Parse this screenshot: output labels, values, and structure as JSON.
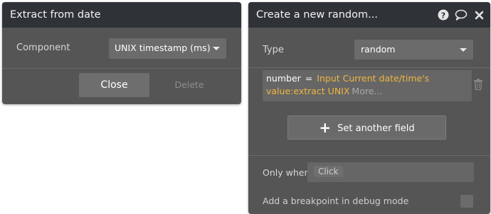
{
  "left_panel": {
    "title": "Extract from date",
    "component_label": "Component",
    "component_value": "UNIX timestamp (ms)",
    "close_label": "Close",
    "delete_label": "Delete"
  },
  "right_panel": {
    "title": "Create a new random...",
    "type_label": "Type",
    "type_value": "random",
    "field": {
      "key": "number",
      "operator": "=",
      "expression": "Input Current date/time's value:extract UNIX",
      "more_label": "More..."
    },
    "set_another_label": "Set another field",
    "only_when_label": "Only when",
    "only_when_placeholder": "Click",
    "breakpoint_label": "Add a breakpoint in debug mode"
  },
  "icons": {
    "help": "help-circle-icon",
    "comment": "comment-bubble-icon",
    "close": "close-x-icon",
    "trash": "trash-icon",
    "plus": "plus-icon",
    "caret": "chevron-down-icon"
  },
  "colors": {
    "header_bg": "#2f3338",
    "panel_bg": "#555555",
    "expression_text": "#efb640"
  }
}
